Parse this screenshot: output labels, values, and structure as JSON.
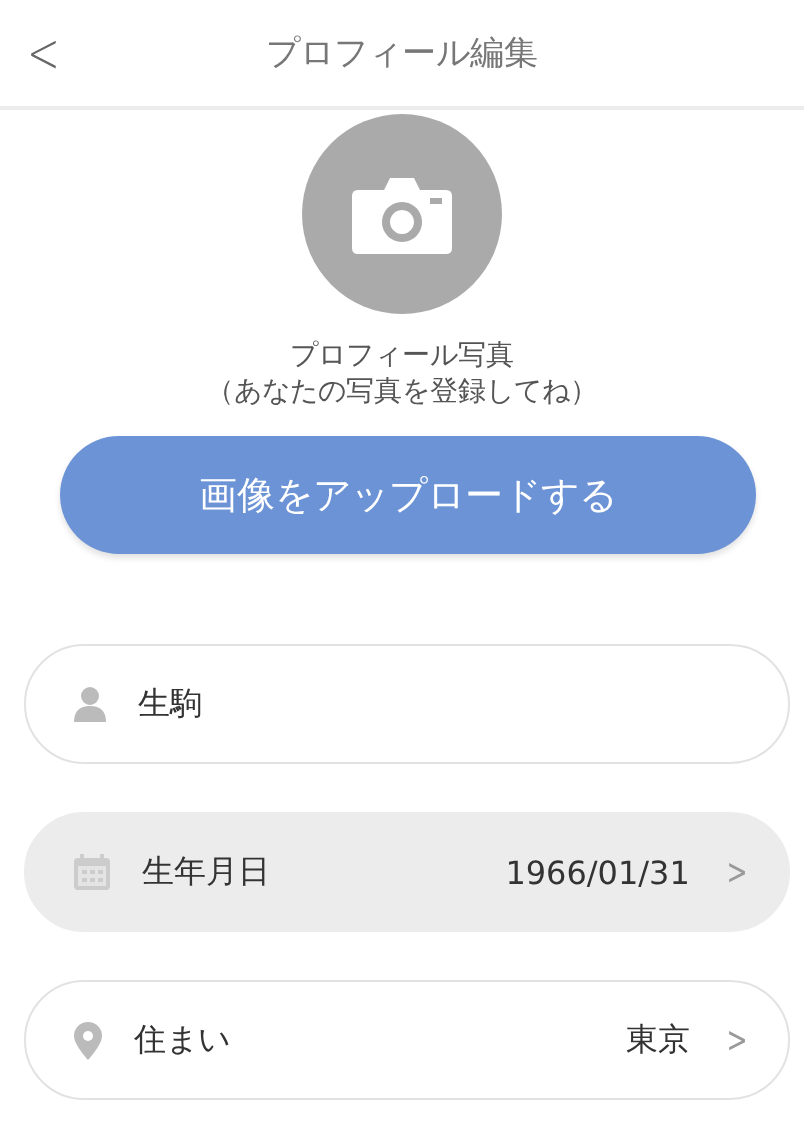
{
  "header": {
    "back": "<",
    "title": "プロフィール編集"
  },
  "photo": {
    "caption": "プロフィール写真",
    "hint": "（あなたの写真を登録してね）"
  },
  "upload_button": "画像をアップロードする",
  "fields": [
    {
      "kind": "text",
      "value": "生駒",
      "pressed": false
    },
    {
      "kind": "date",
      "label": "生年月日",
      "value": "1966/01/31",
      "chevron": ">",
      "pressed": true
    },
    {
      "kind": "location",
      "label": "住まい",
      "value": "東京",
      "chevron": ">",
      "pressed": false
    }
  ]
}
